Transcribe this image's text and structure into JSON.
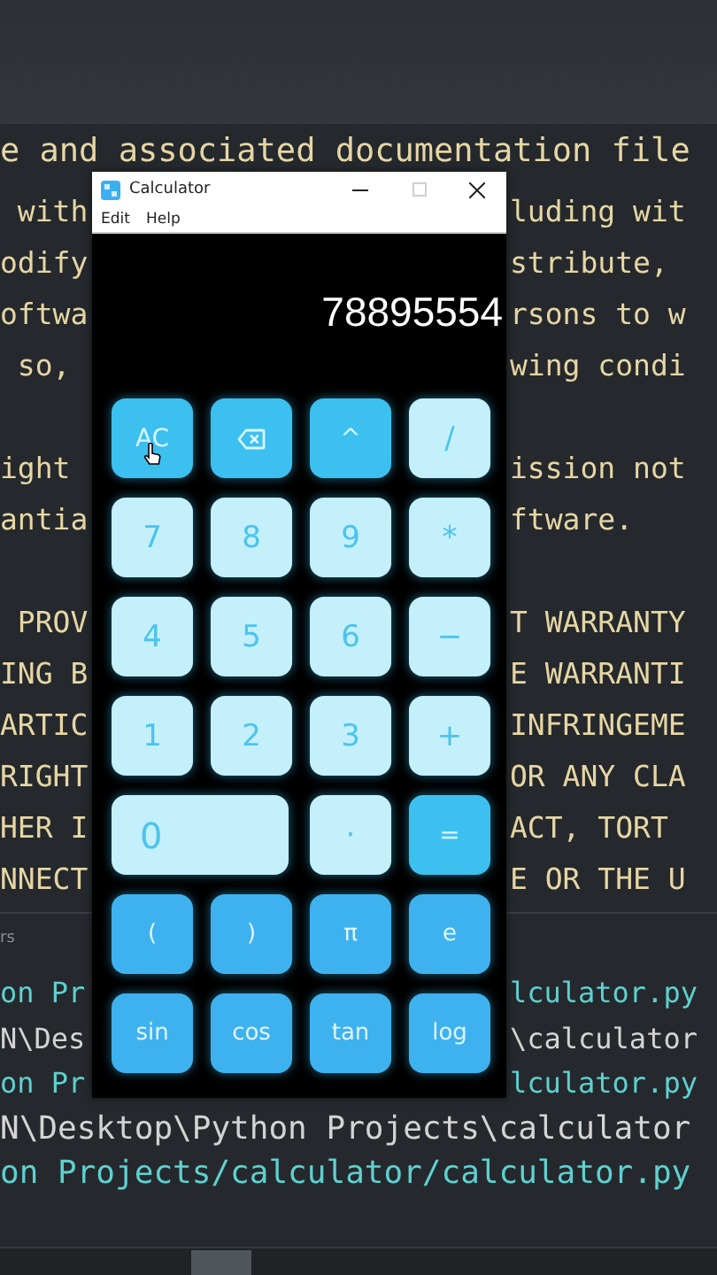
{
  "editor": {
    "lines": [
      {
        "kind": "full",
        "text": "e and associated documentation file"
      },
      {
        "kind": "split",
        "left": " with",
        "right": "luding wit"
      },
      {
        "kind": "split",
        "left": "odify",
        "right": "stribute,"
      },
      {
        "kind": "split",
        "left": "oftwa",
        "right": "rsons to w"
      },
      {
        "kind": "split",
        "left": " so,",
        "right": "wing condi"
      },
      {
        "kind": "blank"
      },
      {
        "kind": "split",
        "left": "ight",
        "right": "ission not"
      },
      {
        "kind": "split",
        "left": "antia",
        "right": "ftware."
      },
      {
        "kind": "blank"
      },
      {
        "kind": "split",
        "left": " PROV",
        "right": "T WARRANTY"
      },
      {
        "kind": "split",
        "left": "ING B",
        "right": "E WARRANTI"
      },
      {
        "kind": "split",
        "left": "ARTIC",
        "right": "INFRINGEME"
      },
      {
        "kind": "split",
        "left": "RIGHT",
        "right": "OR ANY CLA"
      },
      {
        "kind": "split",
        "left": "HER I",
        "right": "ACT, TORT"
      },
      {
        "kind": "split",
        "left": "NNECT",
        "right": "E OR THE U"
      }
    ]
  },
  "terminal": {
    "label": "rs",
    "lines": [
      {
        "kind": "split",
        "left": "on Pr",
        "right": "lculator.py",
        "color": "#5fd0d0"
      },
      {
        "kind": "split",
        "left": "N\\Des",
        "right": "\\calculator",
        "color": "#d4d4d4"
      },
      {
        "kind": "split",
        "left": "on Pr",
        "right": "lculator.py",
        "color": "#5fd0d0"
      },
      {
        "kind": "full",
        "text": "N\\Desktop\\Python Projects\\calculator",
        "color": "#d4d4d4"
      },
      {
        "kind": "full",
        "text": "on Projects/calculator/calculator.py",
        "color": "#5fd0d0"
      }
    ]
  },
  "calculator": {
    "title": "Calculator",
    "maximize_disabled": true,
    "menu": [
      "Edit",
      "Help"
    ],
    "display": "78895554",
    "keys": [
      {
        "kind": "accent",
        "label": "AC"
      },
      {
        "kind": "backspace"
      },
      {
        "kind": "accent",
        "label": "^"
      },
      {
        "kind": "light",
        "label": "/"
      },
      {
        "kind": "light",
        "label": "7"
      },
      {
        "kind": "light",
        "label": "8"
      },
      {
        "kind": "light",
        "label": "9"
      },
      {
        "kind": "light",
        "label": "*"
      },
      {
        "kind": "light",
        "label": "4"
      },
      {
        "kind": "light",
        "label": "5"
      },
      {
        "kind": "light",
        "label": "6"
      },
      {
        "kind": "light",
        "label": "−"
      },
      {
        "kind": "light",
        "label": "1"
      },
      {
        "kind": "light",
        "label": "2"
      },
      {
        "kind": "light",
        "label": "3"
      },
      {
        "kind": "light",
        "label": "+"
      },
      {
        "kind": "wide",
        "label": "0"
      },
      {
        "kind": "light",
        "label": "·"
      },
      {
        "kind": "accent",
        "label": "="
      },
      {
        "kind": "function",
        "label": "("
      },
      {
        "kind": "function",
        "label": ")"
      },
      {
        "kind": "function",
        "label": "π"
      },
      {
        "kind": "function",
        "label": "e"
      },
      {
        "kind": "function",
        "label": "sin"
      },
      {
        "kind": "function",
        "label": "cos"
      },
      {
        "kind": "function",
        "label": "tan"
      },
      {
        "kind": "function",
        "label": "log"
      }
    ]
  }
}
